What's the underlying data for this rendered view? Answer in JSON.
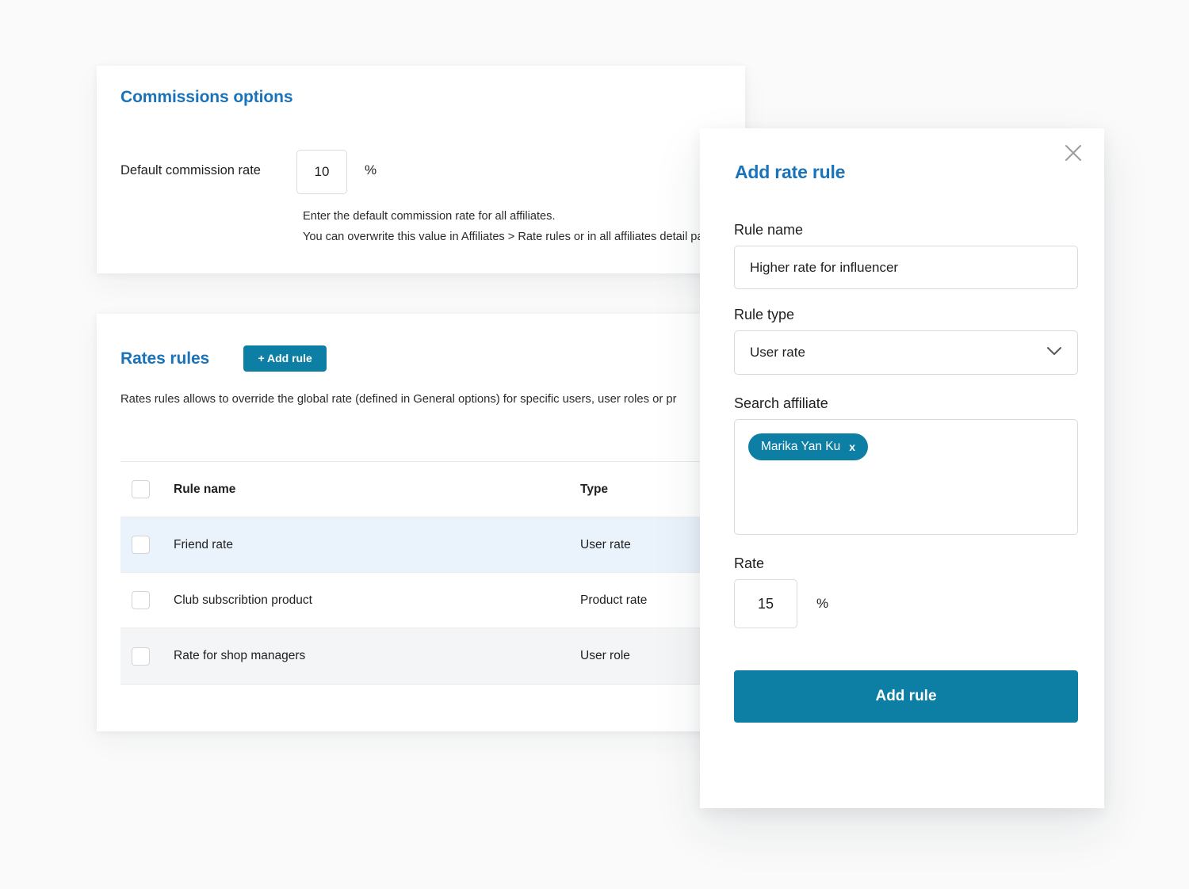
{
  "theme": {
    "heading_blue": "#1a73b8",
    "accent_teal": "#0d7ea4",
    "page_background": "#fafafa",
    "row_highlight_blue": "#eaf2fb",
    "row_highlight_gray": "#f4f5f6"
  },
  "commissions": {
    "title": "Commissions options",
    "field_label": "Default commission rate",
    "rate_value": "10",
    "percent_symbol": "%",
    "helper_line_1": "Enter the default commission rate for all affiliates.",
    "helper_line_2": "You can overwrite this value in Affiliates > Rate rules or in all affiliates detail pa"
  },
  "rates_rules": {
    "title": "Rates rules",
    "add_rule_label": "+ Add rule",
    "description": "Rates rules allows to override the global rate (defined in General options) for specific users, user roles or pr",
    "table": {
      "columns": [
        "Rule name",
        "Type"
      ],
      "rows": [
        {
          "name": "Friend rate",
          "type": "User rate"
        },
        {
          "name": "Club subscribtion product",
          "type": "Product rate"
        },
        {
          "name": "Rate for shop managers",
          "type": "User role"
        }
      ]
    }
  },
  "modal": {
    "title": "Add rate rule",
    "close_icon": "close-icon",
    "rule_name": {
      "label": "Rule name",
      "value": "Higher rate for influencer",
      "placeholder": "Rule name"
    },
    "rule_type": {
      "label": "Rule type",
      "selected": "User rate",
      "chevron_icon": "chevron-down-icon",
      "options": [
        "User rate",
        "User role",
        "Product rate"
      ]
    },
    "search_affiliate": {
      "label": "Search affiliate",
      "placeholder": "Search affiliate",
      "chips": [
        {
          "label": "Marika Yan Ku",
          "remove": "x"
        }
      ]
    },
    "rate": {
      "label": "Rate",
      "value": "15",
      "percent_symbol": "%"
    },
    "submit_label": "Add rule"
  }
}
